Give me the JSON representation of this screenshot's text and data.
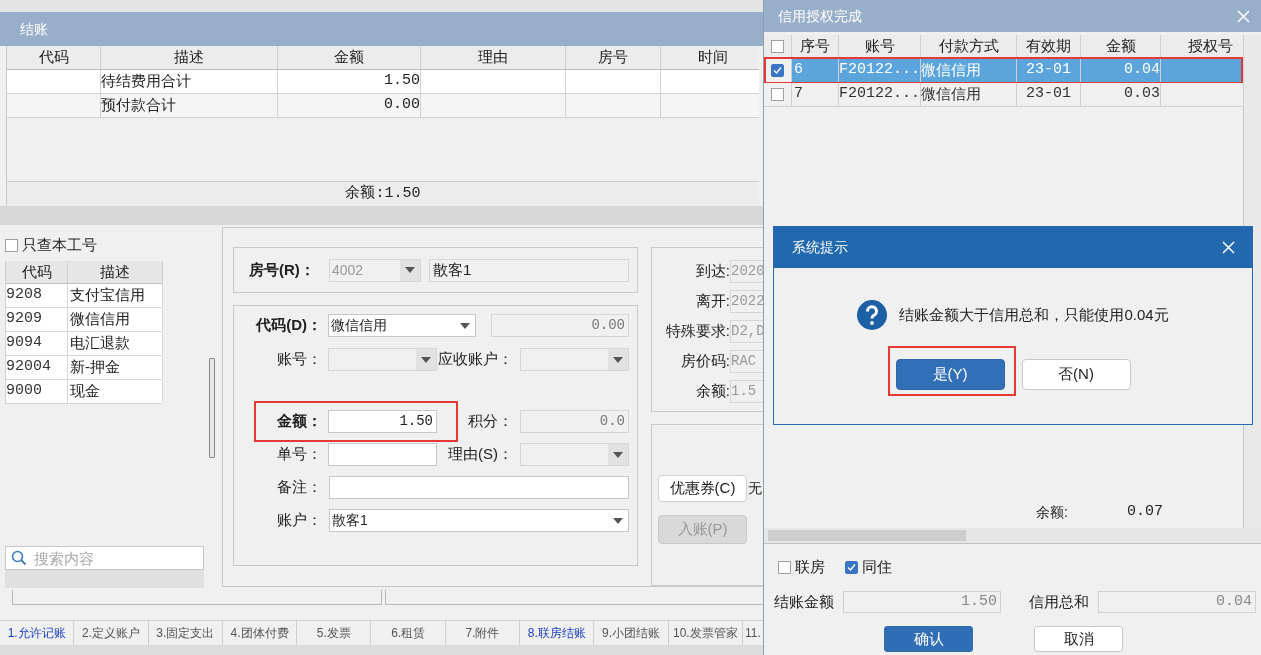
{
  "main_window": {
    "title": "结账",
    "charges_table": {
      "columns": [
        "代码",
        "描述",
        "金额",
        "理由",
        "房号",
        "时间"
      ],
      "rows": [
        {
          "description": "待结费用合计",
          "amount": "1.50"
        },
        {
          "description": "预付款合计",
          "amount": "0.00"
        }
      ]
    },
    "balance": "余额:1.50",
    "staff_filter": {
      "label": "只查本工号",
      "checked": false
    },
    "code_list": {
      "columns": [
        "代码",
        "描述"
      ],
      "rows": [
        {
          "code": "9208",
          "description": "支付宝信用"
        },
        {
          "code": "9209",
          "description": "微信信用"
        },
        {
          "code": "9094",
          "description": "电汇退款"
        },
        {
          "code": "92004",
          "description": "新-押金"
        },
        {
          "code": "9000",
          "description": "现金"
        }
      ]
    },
    "search": {
      "placeholder": "搜索内容"
    },
    "room": {
      "label": "房号(R)：",
      "room_number": "4002",
      "disabled": true,
      "guest": "散客1"
    },
    "payment_form": {
      "code": {
        "label": "代码(D)：",
        "value": "微信信用",
        "disabled": false,
        "amount": "0.00"
      },
      "account_no": {
        "label": "账号：",
        "disabled": true
      },
      "receivable": {
        "label": "应收账户：",
        "disabled": true
      },
      "amount": {
        "label": "金额：",
        "value": "1.50",
        "highlighted": true
      },
      "points": {
        "label": "积分：",
        "value": "0.0"
      },
      "voucher_no": {
        "label": "单号："
      },
      "reason": {
        "label": "理由(S)：",
        "disabled": true
      },
      "remark": {
        "label": "备注："
      },
      "account": {
        "label": "账户：",
        "value": "散客1",
        "disabled": false
      }
    },
    "stay_info": [
      {
        "label": "到达:",
        "value": "2020"
      },
      {
        "label": "离开:",
        "value": "2022"
      },
      {
        "label": "特殊要求:",
        "value": "D2,D"
      },
      {
        "label": "房价码:",
        "value": "RAC"
      },
      {
        "label": "余额:",
        "value": "1.5"
      }
    ],
    "coupon": {
      "button": "优惠券(C)",
      "text": "无"
    },
    "post_button": {
      "label": "入账(P)",
      "disabled": true
    },
    "bottom_tabs": [
      {
        "label": "1.允许记账",
        "active": true
      },
      {
        "label": "2.定义账户",
        "active": false
      },
      {
        "label": "3.固定支出",
        "active": false
      },
      {
        "label": "4.团体付费",
        "active": false
      },
      {
        "label": "5.发票",
        "active": false
      },
      {
        "label": "6.租赁",
        "active": false
      },
      {
        "label": "7.附件",
        "active": false
      },
      {
        "label": "8.联房结账",
        "active": true
      },
      {
        "label": "9.小团结账",
        "active": false
      },
      {
        "label": "10.发票管家",
        "active": false
      },
      {
        "label": "11.",
        "active": false
      }
    ]
  },
  "auth_window": {
    "title": "信用授权完成",
    "columns": [
      "序号",
      "账号",
      "付款方式",
      "有效期",
      "金额",
      "授权号"
    ],
    "all_checked": false,
    "rows": [
      {
        "no": "6",
        "account": "F20122...",
        "method": "微信信用",
        "expiry": "23-01",
        "amount": "0.04",
        "checked": true,
        "selected": true,
        "highlighted": true
      },
      {
        "no": "7",
        "account": "F20122...",
        "method": "微信信用",
        "expiry": "23-01",
        "amount": "0.03",
        "checked": false,
        "selected": false,
        "highlighted": false
      }
    ],
    "balance_label": "余额:",
    "balance": "0.07",
    "options": [
      {
        "label": "联房",
        "checked": false
      },
      {
        "label": "同住",
        "checked": true
      }
    ],
    "totals": [
      {
        "label": "结账金额",
        "value": "1.50"
      },
      {
        "label": "信用总和",
        "value": "0.04"
      }
    ],
    "buttons": [
      {
        "label": "确认",
        "kind": "primary"
      },
      {
        "label": "取消",
        "kind": "default"
      }
    ]
  },
  "dialog": {
    "title": "系统提示",
    "message": "结账金额大于信用总和，只能使用0.04元",
    "buttons": [
      {
        "label": "是(Y)",
        "kind": "primary",
        "highlighted": true
      },
      {
        "label": "否(N)",
        "kind": "default",
        "highlighted": false
      }
    ]
  }
}
